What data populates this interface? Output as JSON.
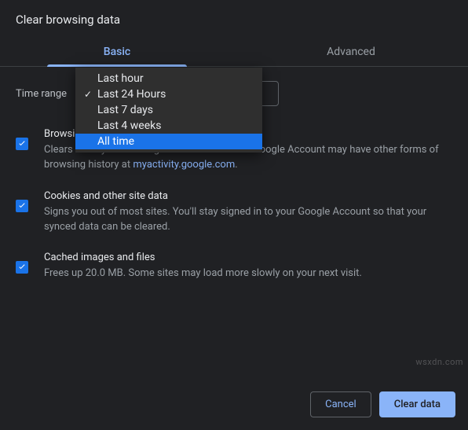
{
  "title": "Clear browsing data",
  "tabs": {
    "basic": "Basic",
    "advanced": "Advanced"
  },
  "time_range": {
    "label": "Time range",
    "options": [
      {
        "label": "Last hour",
        "selected": false,
        "highlight": false
      },
      {
        "label": "Last 24 Hours",
        "selected": true,
        "highlight": false
      },
      {
        "label": "Last 7 days",
        "selected": false,
        "highlight": false
      },
      {
        "label": "Last 4 weeks",
        "selected": false,
        "highlight": false
      },
      {
        "label": "All time",
        "selected": false,
        "highlight": true
      }
    ]
  },
  "items": {
    "history": {
      "title": "Browsing history",
      "desc_a": "Clears history from all signed-in devices. Your Google Account may have other forms of browsing history at ",
      "desc_link": "myactivity.google.com",
      "desc_b": "."
    },
    "cookies": {
      "title": "Cookies and other site data",
      "desc": "Signs you out of most sites. You'll stay signed in to your Google Account so that your synced data can be cleared."
    },
    "cache": {
      "title": "Cached images and files",
      "desc": "Frees up 20.0 MB. Some sites may load more slowly on your next visit."
    }
  },
  "buttons": {
    "cancel": "Cancel",
    "clear": "Clear data"
  },
  "watermark": "wsxdn.com"
}
